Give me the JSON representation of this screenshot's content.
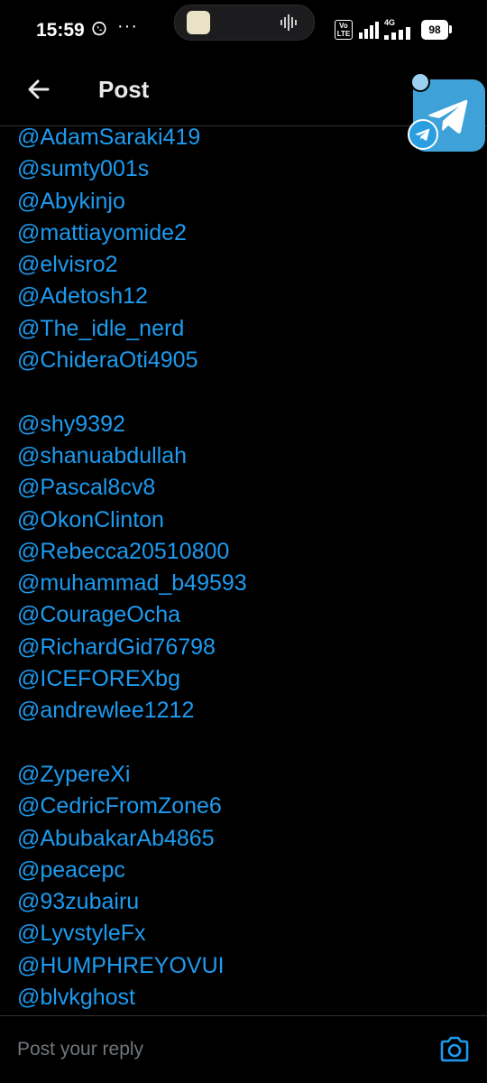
{
  "status_bar": {
    "time": "15:59",
    "overflow_dots": "···",
    "volte_label": "Vo\nLTE",
    "network_label": "4G",
    "battery_level": "98"
  },
  "header": {
    "title": "Post",
    "back_icon": "arrow-left-icon"
  },
  "floating_bubble": {
    "app_icon": "telegram-icon"
  },
  "post": {
    "handles": [
      "@AdamSaraki419",
      "@sumty001s",
      "@Abykinjo",
      "@mattiayomide2",
      "@elvisro2",
      "@Adetosh12",
      "@The_idle_nerd",
      "@ChideraOti4905",
      "",
      "@shy9392",
      "@shanuabdullah",
      "@Pascal8cv8",
      "@OkonClinton",
      "@Rebecca20510800",
      "@muhammad_b49593",
      "@CourageOcha",
      "@RichardGid76798",
      "@ICEFOREXbg",
      "@andrewlee1212",
      "",
      "@ZypereXi",
      "@CedricFromZone6",
      "@AbubakarAb4865",
      "@peacepc",
      "@93zubairu",
      "@LyvstyleFx",
      "@HUMPHREYOVUI",
      "@blvkghost"
    ]
  },
  "reply_bar": {
    "placeholder": "Post your reply",
    "camera_icon": "camera-icon"
  },
  "colors": {
    "background": "#000000",
    "link": "#1d9bf0",
    "text": "#e7e9ea",
    "muted": "#71767b",
    "divider": "#2f3336",
    "telegram": "#3ea2d9"
  }
}
